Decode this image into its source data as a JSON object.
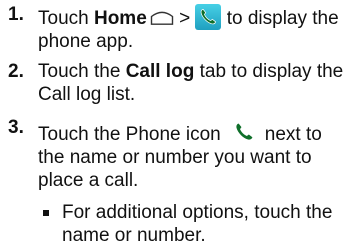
{
  "steps": [
    {
      "number": "1.",
      "pre": "Touch",
      "bold": "Home",
      "separator": ">",
      "post": "to display the phone app.",
      "icons": [
        "home-icon",
        "phone-app-icon"
      ]
    },
    {
      "number": "2.",
      "pre": "Touch the",
      "bold": "Call log",
      "post": "tab to display the Call log list."
    },
    {
      "number": "3.",
      "pre": "Touch the Phone icon",
      "post": "next to the name or number you want to place a call.",
      "icons": [
        "phone-icon"
      ],
      "bullet": "For additional options, touch the name or number."
    }
  ],
  "colors": {
    "text": "#111111",
    "phone_icon_bg": "#2db7d3",
    "phone_handset": "#0f6f2a"
  }
}
